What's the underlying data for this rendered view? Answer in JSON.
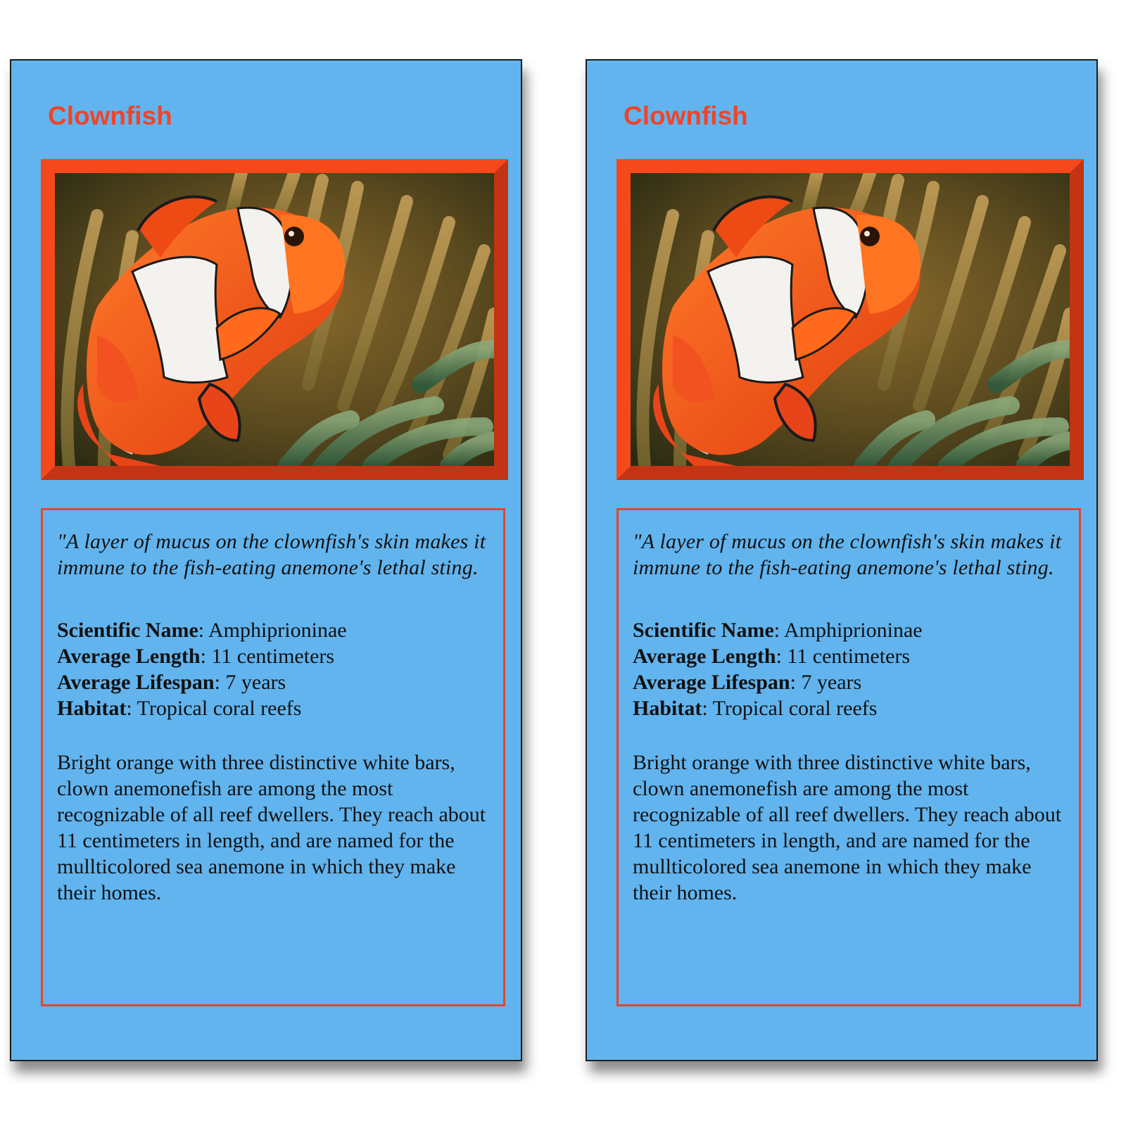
{
  "cards": [
    {
      "title": "Clownfish",
      "image_subject": "clownfish-among-sea-anemone",
      "quote": "\"A layer of mucus on the clownfish's skin makes it immune to the fish-eating anemone's lethal sting.",
      "facts": [
        {
          "label": "Scientific Name",
          "value": ": Amphiprioninae"
        },
        {
          "label": "Average Length",
          "value": ": 11 centimeters"
        },
        {
          "label": "Average Lifespan",
          "value": ": 7 years"
        },
        {
          "label": "Habitat",
          "value": ": Tropical coral reefs"
        }
      ],
      "description": "Bright orange with three distinctive white bars, clown anemonefish are among the most recognizable of all reef dwellers. They reach about 11 centimeters in length, and are named for the mullticolored sea anemone in which they make their homes."
    },
    {
      "title": "Clownfish",
      "image_subject": "clownfish-among-sea-anemone",
      "quote": "\"A layer of mucus on the clownfish's skin makes it immune to the fish-eating anemone's lethal sting.",
      "facts": [
        {
          "label": "Scientific Name",
          "value": ": Amphiprioninae"
        },
        {
          "label": "Average Length",
          "value": ": 11 centimeters"
        },
        {
          "label": "Average Lifespan",
          "value": ": 7 years"
        },
        {
          "label": "Habitat",
          "value": ": Tropical coral reefs"
        }
      ],
      "description": "Bright orange with three distinctive white bars, clown anemonefish are among the most recognizable of all reef dwellers. They reach about 11 centimeters in length, and are named for the mullticolored sea anemone in which they make their homes."
    }
  ],
  "colors": {
    "card_background": "#62b4ee",
    "accent": "#f0442a",
    "frame": "#f5491c",
    "text": "#111111"
  }
}
